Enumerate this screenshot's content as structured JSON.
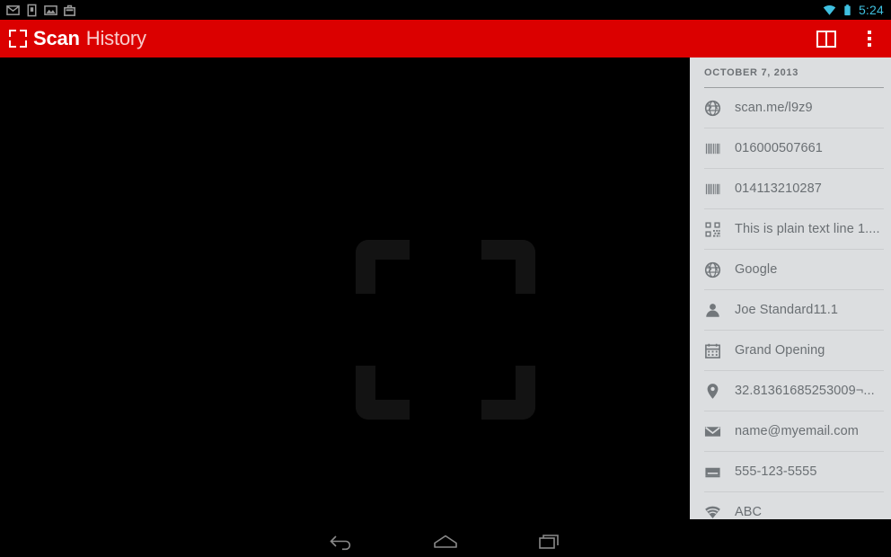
{
  "status_bar": {
    "left_icons": [
      {
        "name": "mail-icon",
        "label": "Mail"
      },
      {
        "name": "sim-card-icon",
        "label": "SIM card"
      },
      {
        "name": "photo-icon",
        "label": "Photo"
      },
      {
        "name": "briefcase-icon",
        "label": "Briefcase"
      }
    ],
    "wifi_icon": "wifi-icon",
    "battery_icon": "battery-icon",
    "clock": "5:24",
    "clock_color": "#3fc0e0",
    "background_color": "#000000"
  },
  "action_bar": {
    "logo_icon": "scan-frame-logo-icon",
    "title_primary": "Scan",
    "title_secondary": "History",
    "background_color": "#db0000",
    "actions": [
      {
        "name": "book-button",
        "icon": "book-icon",
        "label": "Book"
      },
      {
        "name": "overflow-menu-button",
        "icon": "overflow-menu-icon",
        "label": "More options"
      }
    ]
  },
  "viewfinder": {
    "background_color": "#000000",
    "frame_color": "#131313",
    "frame_icon": "scan-target-frame-icon"
  },
  "history_panel": {
    "background_color": "#dcdee0",
    "date_header": "OCTOBER 7, 2013",
    "items": [
      {
        "icon": "globe-icon",
        "label": "scan.me/l9z9"
      },
      {
        "icon": "barcode-icon",
        "label": "016000507661"
      },
      {
        "icon": "barcode-icon",
        "label": "014113210287"
      },
      {
        "icon": "qr-code-icon",
        "label": "This is plain text line 1...."
      },
      {
        "icon": "globe-icon",
        "label": "Google"
      },
      {
        "icon": "person-icon",
        "label": "Joe Standard11.1"
      },
      {
        "icon": "calendar-icon",
        "label": "Grand Opening"
      },
      {
        "icon": "location-pin-icon",
        "label": "32.81361685253009¬..."
      },
      {
        "icon": "envelope-icon",
        "label": "name@myemail.com"
      },
      {
        "icon": "sms-card-icon",
        "label": "555-123-5555"
      },
      {
        "icon": "wifi-icon",
        "label": "ABC"
      }
    ]
  },
  "nav_bar": {
    "background_color": "#000000",
    "buttons": [
      {
        "name": "back-button",
        "icon": "back-arrow-icon",
        "label": "Back"
      },
      {
        "name": "home-button",
        "icon": "home-icon",
        "label": "Home"
      },
      {
        "name": "recents-button",
        "icon": "recents-icon",
        "label": "Recent apps"
      }
    ]
  }
}
